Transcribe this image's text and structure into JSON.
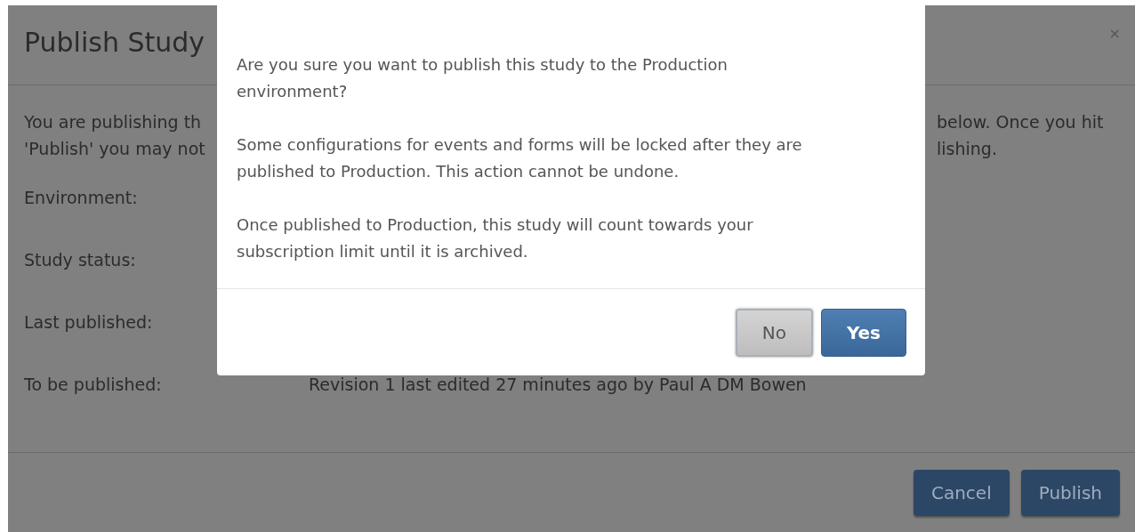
{
  "background_dialog": {
    "title": "Publish Study",
    "close": "×",
    "intro_left": [
      "You are publishing th",
      "'Publish' you may not"
    ],
    "intro_right": [
      "below. Once you hit",
      "lishing."
    ],
    "fields": [
      {
        "label": "Environment:"
      },
      {
        "label": "Study status:"
      },
      {
        "label": "Last published:"
      },
      {
        "label": "To be published:",
        "value": "Revision 1 last edited 27 minutes ago by Paul A DM Bowen"
      }
    ],
    "buttons": [
      "Cancel",
      "Publish"
    ]
  },
  "confirm_dialog": {
    "paragraphs": [
      {
        "lines": [
          "Are you sure you want to publish this study to the Production",
          "environment?"
        ]
      },
      {
        "lines": [
          "Some configurations for events and forms will be locked after they are",
          "published to Production. This action cannot be undone."
        ]
      },
      {
        "lines": [
          "Once published to Production, this study will count towards your",
          "subscription limit until it is archived."
        ]
      }
    ],
    "buttons": [
      {
        "label": "No",
        "kind": "secondary"
      },
      {
        "label": "Yes",
        "kind": "primary"
      }
    ]
  }
}
